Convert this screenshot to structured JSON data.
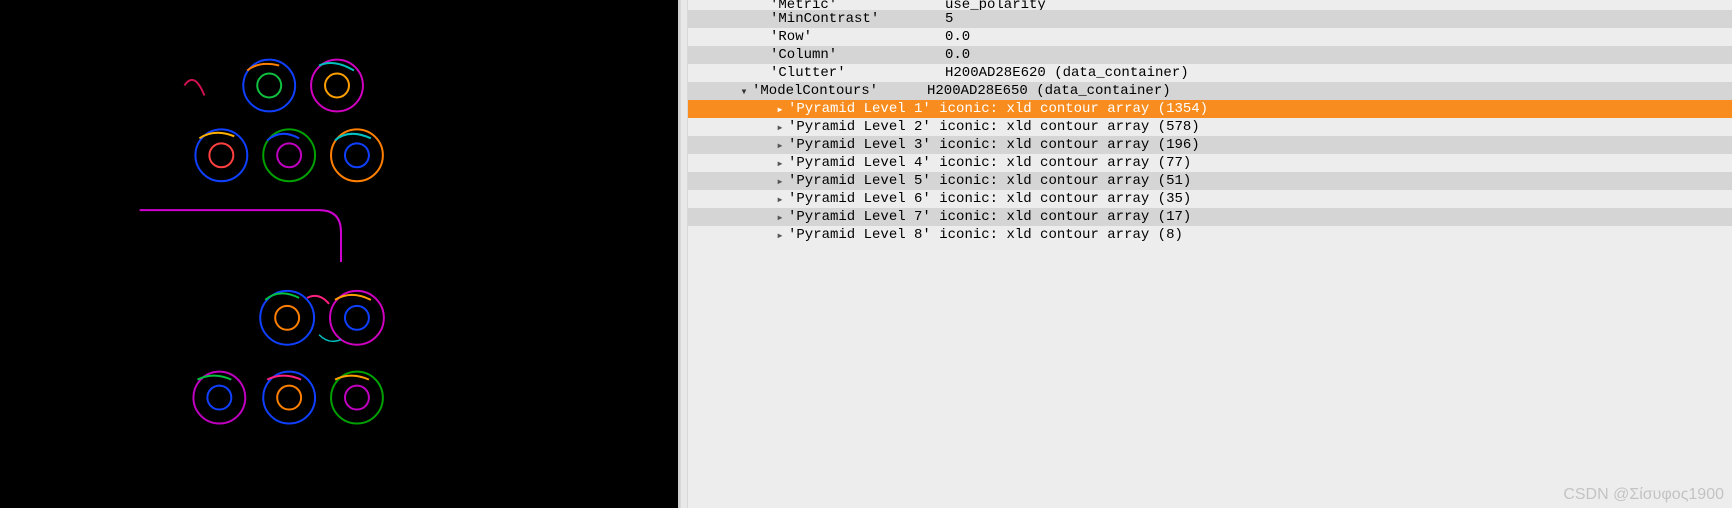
{
  "params": [
    {
      "key": "'Metric'",
      "value": "use_polarity"
    },
    {
      "key": "'MinContrast'",
      "value": "5"
    },
    {
      "key": "'Row'",
      "value": "0.0"
    },
    {
      "key": "'Column'",
      "value": "0.0"
    },
    {
      "key": "'Clutter'",
      "value": "H200AD28E620 (data_container)"
    },
    {
      "key": "'ModelContours'",
      "value": "H200AD28E650 (data_container)",
      "expandable": true,
      "expanded": true
    }
  ],
  "children": [
    {
      "label": "'Pyramid Level 1'",
      "detail": "iconic: xld contour array (1354)",
      "selected": true
    },
    {
      "label": "'Pyramid Level 2'",
      "detail": "iconic: xld contour array (578)"
    },
    {
      "label": "'Pyramid Level 3'",
      "detail": "iconic: xld contour array (196)"
    },
    {
      "label": "'Pyramid Level 4'",
      "detail": "iconic: xld contour array (77)"
    },
    {
      "label": "'Pyramid Level 5'",
      "detail": "iconic: xld contour array (51)"
    },
    {
      "label": "'Pyramid Level 6'",
      "detail": "iconic: xld contour array (35)"
    },
    {
      "label": "'Pyramid Level 7'",
      "detail": "iconic: xld contour array (17)"
    },
    {
      "label": "'Pyramid Level 8'",
      "detail": "iconic: xld contour array (8)"
    }
  ],
  "watermark": "CSDN @Σίσυφος1900"
}
